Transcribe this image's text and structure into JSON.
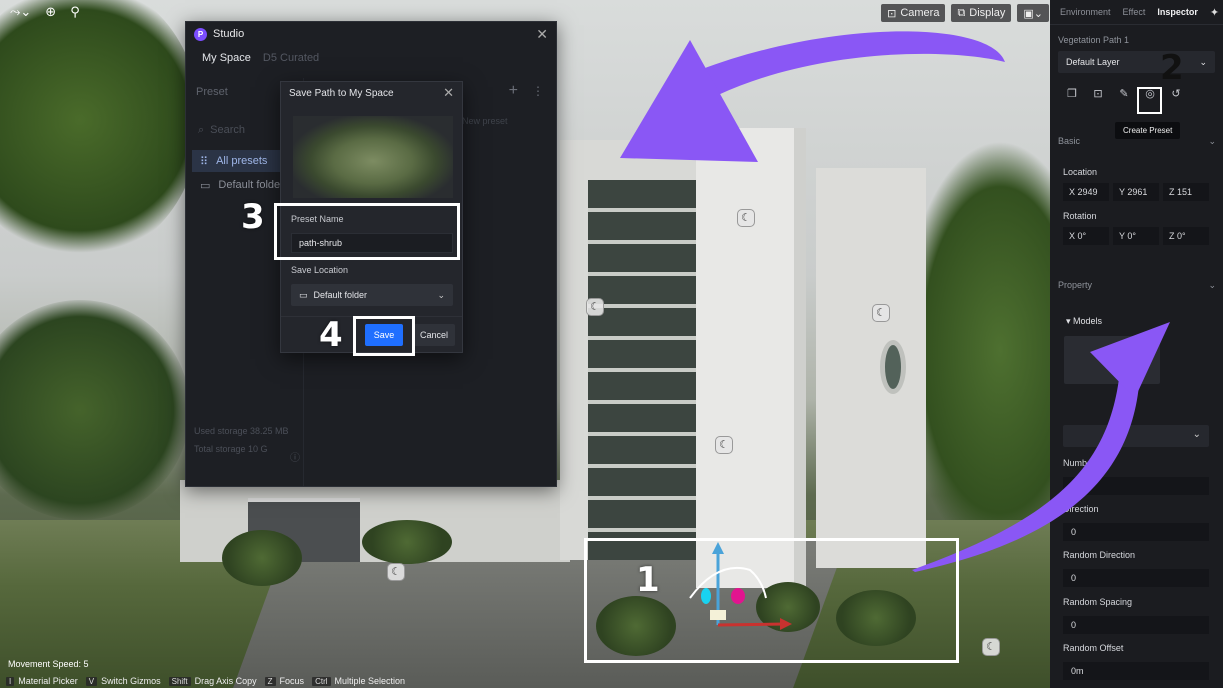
{
  "viewport": {
    "toolbar_icons": [
      "transform-icon",
      "globe-icon",
      "wand-icon"
    ],
    "buttons": {
      "camera": "Camera",
      "display": "Display"
    },
    "movement_speed": "Movement Speed: 5",
    "shortcuts": [
      {
        "key": "I",
        "label": "Material Picker"
      },
      {
        "key": "V",
        "label": "Switch Gizmos"
      },
      {
        "key": "Shift",
        "label": "Drag Axis Copy"
      },
      {
        "key": "Z",
        "label": "Focus"
      },
      {
        "key": "Ctrl",
        "label": "Multiple Selection"
      }
    ]
  },
  "studio": {
    "title": "Studio",
    "logo_letter": "P",
    "tabs": {
      "my_space": "My Space",
      "curated": "D5 Curated"
    },
    "preset_header": "Preset",
    "search_placeholder": "Search",
    "folders": {
      "all": "All presets",
      "default": "Default folder"
    },
    "new_preset_hint": "New preset",
    "storage": {
      "used": "Used storage 38.25 MB",
      "total": "Total storage 10 G"
    }
  },
  "dialog": {
    "title": "Save Path to My Space",
    "preset_name_label": "Preset Name",
    "preset_name_value": "path-shrub",
    "save_location_label": "Save Location",
    "save_location_value": "Default folder",
    "save": "Save",
    "cancel": "Cancel"
  },
  "inspector": {
    "tabs": {
      "environment": "Environment",
      "effect": "Effect",
      "inspector": "Inspector"
    },
    "object_name": "Vegetation Path 1",
    "layer": "Default Layer",
    "tooltip": "Create Preset",
    "basic": {
      "title": "Basic",
      "location_label": "Location",
      "location": {
        "x": "X  2949",
        "y": "Y  2961",
        "z": "Z  151"
      },
      "rotation_label": "Rotation",
      "rotation": {
        "x": "X  0°",
        "y": "Y  0°",
        "z": "Z  0°"
      }
    },
    "property": {
      "title": "Property",
      "models_label": "Models",
      "number_label": "Number",
      "number_value": "5",
      "direction_label": "Direction",
      "direction_value": "0",
      "random_direction_label": "Random Direction",
      "random_direction_value": "0",
      "random_spacing_label": "Random Spacing",
      "random_spacing_value": "0",
      "random_offset_label": "Random Offset",
      "random_offset_value": "0m"
    }
  },
  "annotations": {
    "step1": "1",
    "step2": "2",
    "step3": "3",
    "step4": "4",
    "arrow_color": "#8a57f5"
  }
}
